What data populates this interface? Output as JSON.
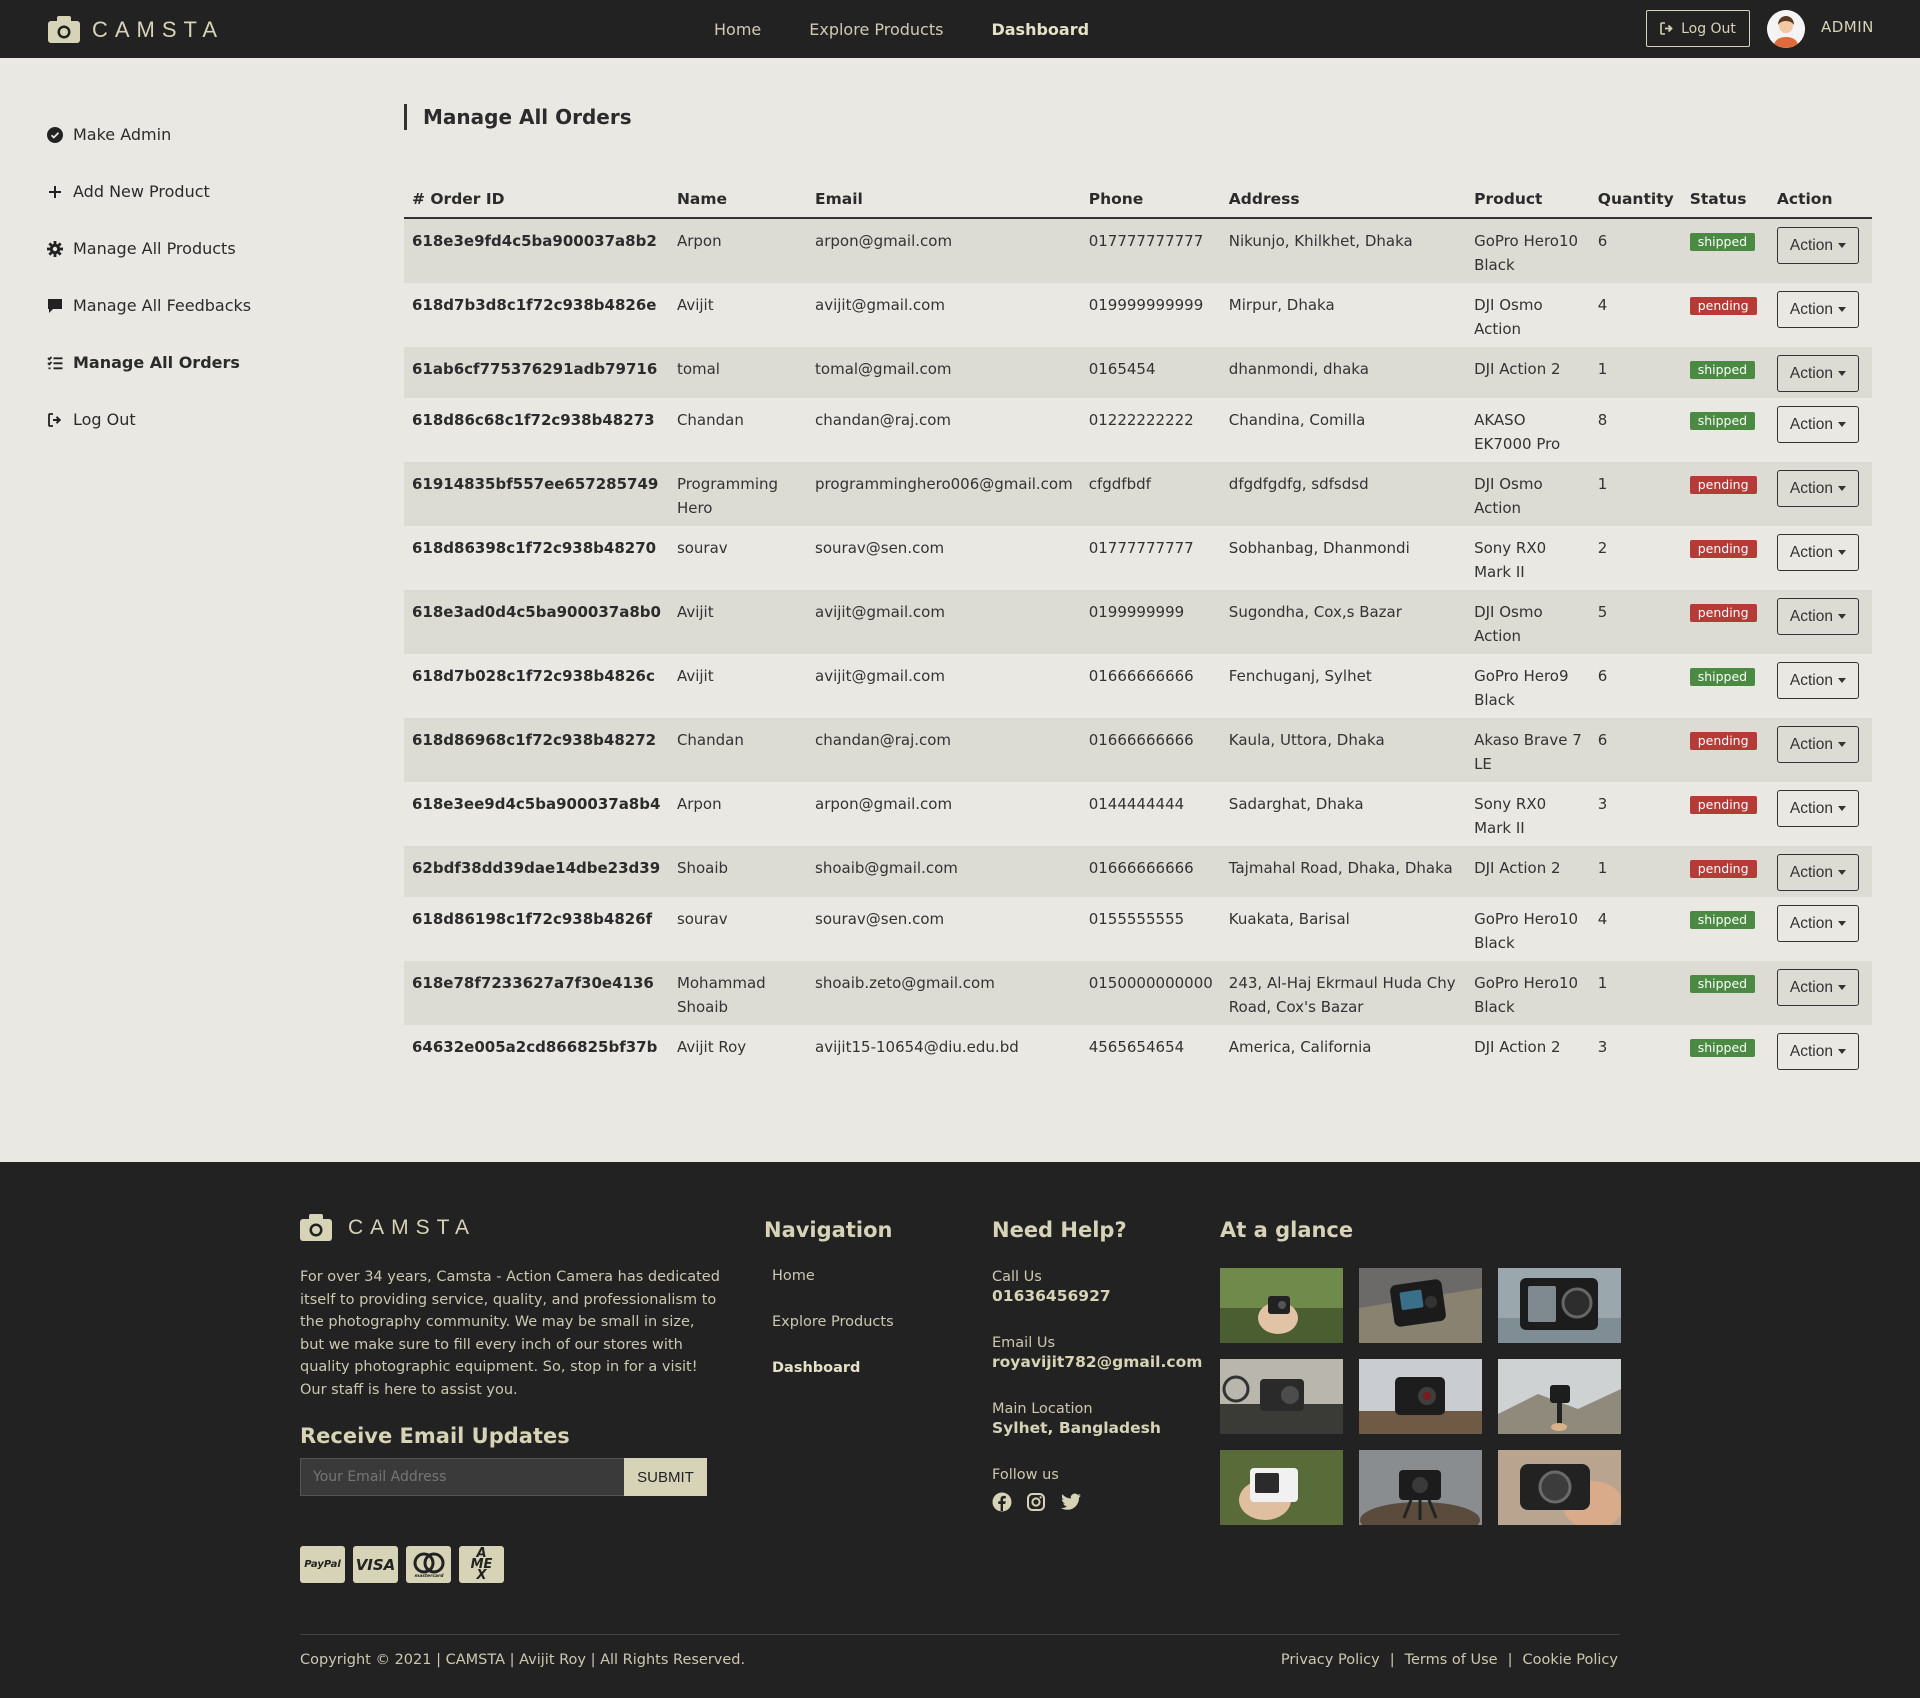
{
  "brand": {
    "name": "CAMSTA"
  },
  "topnav": {
    "links": [
      "Home",
      "Explore Products",
      "Dashboard"
    ],
    "active": "Dashboard",
    "logout_label": "Log Out",
    "user_label": "ADMIN"
  },
  "sidebar": {
    "items": [
      {
        "label": "Make Admin",
        "icon": "check-circle-icon"
      },
      {
        "label": "Add New Product",
        "icon": "plus-icon"
      },
      {
        "label": "Manage All Products",
        "icon": "gear-icon"
      },
      {
        "label": "Manage All Feedbacks",
        "icon": "comment-icon"
      },
      {
        "label": "Manage All Orders",
        "icon": "list-check-icon",
        "active": true
      },
      {
        "label": "Log Out",
        "icon": "sign-out-icon"
      }
    ]
  },
  "main": {
    "title": "Manage All Orders",
    "columns": [
      "# Order ID",
      "Name",
      "Email",
      "Phone",
      "Address",
      "Product",
      "Quantity",
      "Status",
      "Action"
    ],
    "action_label": "Action",
    "rows": [
      {
        "id": "618e3e9fd4c5ba900037a8b2",
        "name": "Arpon",
        "email": "arpon@gmail.com",
        "phone": "017777777777",
        "address": "Nikunjo, Khilkhet, Dhaka",
        "product": "GoPro Hero10 Black",
        "qty": "6",
        "status": "shipped"
      },
      {
        "id": "618d7b3d8c1f72c938b4826e",
        "name": "Avijit",
        "email": "avijit@gmail.com",
        "phone": "019999999999",
        "address": "Mirpur, Dhaka",
        "product": "DJI Osmo Action",
        "qty": "4",
        "status": "pending"
      },
      {
        "id": "61ab6cf775376291adb79716",
        "name": "tomal",
        "email": "tomal@gmail.com",
        "phone": "0165454",
        "address": "dhanmondi, dhaka",
        "product": "DJI Action 2",
        "qty": "1",
        "status": "shipped"
      },
      {
        "id": "618d86c68c1f72c938b48273",
        "name": "Chandan",
        "email": "chandan@raj.com",
        "phone": "01222222222",
        "address": "Chandina, Comilla",
        "product": "AKASO EK7000 Pro",
        "qty": "8",
        "status": "shipped"
      },
      {
        "id": "61914835bf557ee657285749",
        "name": "Programming Hero",
        "email": "programminghero006@gmail.com",
        "phone": "cfgdfbdf",
        "address": "dfgdfgdfg, sdfsdsd",
        "product": "DJI Osmo Action",
        "qty": "1",
        "status": "pending"
      },
      {
        "id": "618d86398c1f72c938b48270",
        "name": "sourav",
        "email": "sourav@sen.com",
        "phone": "01777777777",
        "address": "Sobhanbag, Dhanmondi",
        "product": "Sony RX0 Mark II",
        "qty": "2",
        "status": "pending"
      },
      {
        "id": "618e3ad0d4c5ba900037a8b0",
        "name": "Avijit",
        "email": "avijit@gmail.com",
        "phone": "0199999999",
        "address": "Sugondha, Cox,s Bazar",
        "product": "DJI Osmo Action",
        "qty": "5",
        "status": "pending"
      },
      {
        "id": "618d7b028c1f72c938b4826c",
        "name": "Avijit",
        "email": "avijit@gmail.com",
        "phone": "01666666666",
        "address": "Fenchuganj, Sylhet",
        "product": "GoPro Hero9 Black",
        "qty": "6",
        "status": "shipped"
      },
      {
        "id": "618d86968c1f72c938b48272",
        "name": "Chandan",
        "email": "chandan@raj.com",
        "phone": "01666666666",
        "address": "Kaula, Uttora, Dhaka",
        "product": "Akaso Brave 7 LE",
        "qty": "6",
        "status": "pending"
      },
      {
        "id": "618e3ee9d4c5ba900037a8b4",
        "name": "Arpon",
        "email": "arpon@gmail.com",
        "phone": "0144444444",
        "address": "Sadarghat, Dhaka",
        "product": "Sony RX0 Mark II",
        "qty": "3",
        "status": "pending"
      },
      {
        "id": "62bdf38dd39dae14dbe23d39",
        "name": "Shoaib",
        "email": "shoaib@gmail.com",
        "phone": "01666666666",
        "address": "Tajmahal Road, Dhaka, Dhaka",
        "product": "DJI Action 2",
        "qty": "1",
        "status": "pending"
      },
      {
        "id": "618d86198c1f72c938b4826f",
        "name": "sourav",
        "email": "sourav@sen.com",
        "phone": "0155555555",
        "address": "Kuakata, Barisal",
        "product": "GoPro Hero10 Black",
        "qty": "4",
        "status": "shipped"
      },
      {
        "id": "618e78f7233627a7f30e4136",
        "name": "Mohammad Shoaib",
        "email": "shoaib.zeto@gmail.com",
        "phone": "0150000000000",
        "address": "243, Al-Haj Ekrmaul Huda Chy Road, Cox's Bazar",
        "product": "GoPro Hero10 Black",
        "qty": "1",
        "status": "shipped"
      },
      {
        "id": "64632e005a2cd866825bf37b",
        "name": "Avijit Roy",
        "email": "avijit15-10654@diu.edu.bd",
        "phone": "4565654654",
        "address": "America, California",
        "product": "DJI Action 2",
        "qty": "3",
        "status": "shipped"
      }
    ]
  },
  "footer": {
    "brand": "CAMSTA",
    "about": "For over 34 years, Camsta - Action Camera has dedicated itself to providing service, quality, and professionalism to the photography community. We may be small in size, but we make sure to fill every inch of our stores with quality photographic equipment. So, stop in for a visit! Our staff is here to assist you.",
    "subscribe_title": "Receive Email Updates",
    "email_placeholder": "Your Email Address",
    "submit_label": "SUBMIT",
    "payments": [
      "PayPal",
      "VISA",
      "mastercard",
      "AMEX"
    ],
    "navigation_title": "Navigation",
    "navigation_links": [
      "Home",
      "Explore Products",
      "Dashboard"
    ],
    "help_title": "Need Help?",
    "call_label": "Call Us",
    "call_value": "01636456927",
    "email_label": "Email Us",
    "email_value": "royavijit782@gmail.com",
    "location_label": "Main Location",
    "location_value": "Sylhet, Bangladesh",
    "follow_label": "Follow us",
    "socials": [
      "facebook-icon",
      "instagram-icon",
      "twitter-icon"
    ],
    "glance_title": "At a glance",
    "copyright": "Copyright © 2021 | CAMSTA | Avijit Roy | All Rights Reserved.",
    "legal_links": [
      "Privacy Policy",
      "|",
      "Terms of Use",
      "|",
      "Cookie Policy"
    ]
  },
  "colors": {
    "dark": "#222222",
    "page_bg": "#e9e8e2",
    "accent": "#d6d3b6",
    "shipped": "#4a8a42",
    "pending": "#b63a35"
  }
}
